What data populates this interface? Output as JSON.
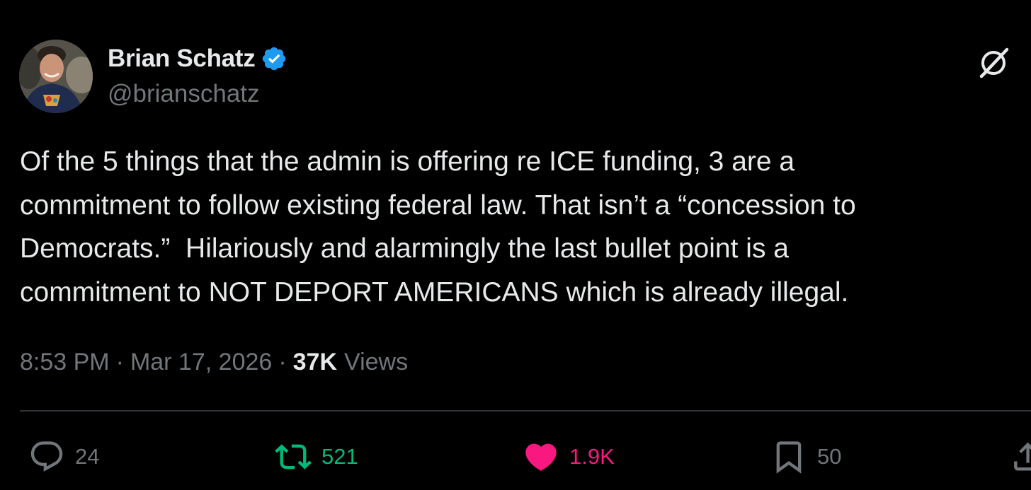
{
  "author": {
    "name": "Brian Schatz",
    "handle": "@brianschatz",
    "verified": true
  },
  "tweet": {
    "text": "Of the 5 things that the admin is offering re ICE funding, 3 are a\ncommitment to follow existing federal law. That isn’t a “concession to\nDemocrats.”  Hilariously and alarmingly the last bullet point is a\ncommitment to NOT DEPORT AMERICANS which is already illegal."
  },
  "meta": {
    "time": "8:53 PM",
    "separator": "·",
    "date": "Mar 17, 2026",
    "views_count": "37K",
    "views_label": "Views"
  },
  "actions": {
    "replies": "24",
    "retweets": "521",
    "likes": "1.9K",
    "bookmarks": "50"
  },
  "colors": {
    "background": "#000000",
    "text": "#e7e9ea",
    "secondary": "#71767b",
    "verified": "#1d9bf0",
    "retweet_active": "#00ba7c",
    "like_active": "#f91880",
    "divider": "#2f3336"
  },
  "icons": [
    "avatar-photo",
    "verified-badge-icon",
    "grok-icon",
    "reply-icon",
    "retweet-icon",
    "like-icon",
    "bookmark-icon",
    "share-icon"
  ]
}
